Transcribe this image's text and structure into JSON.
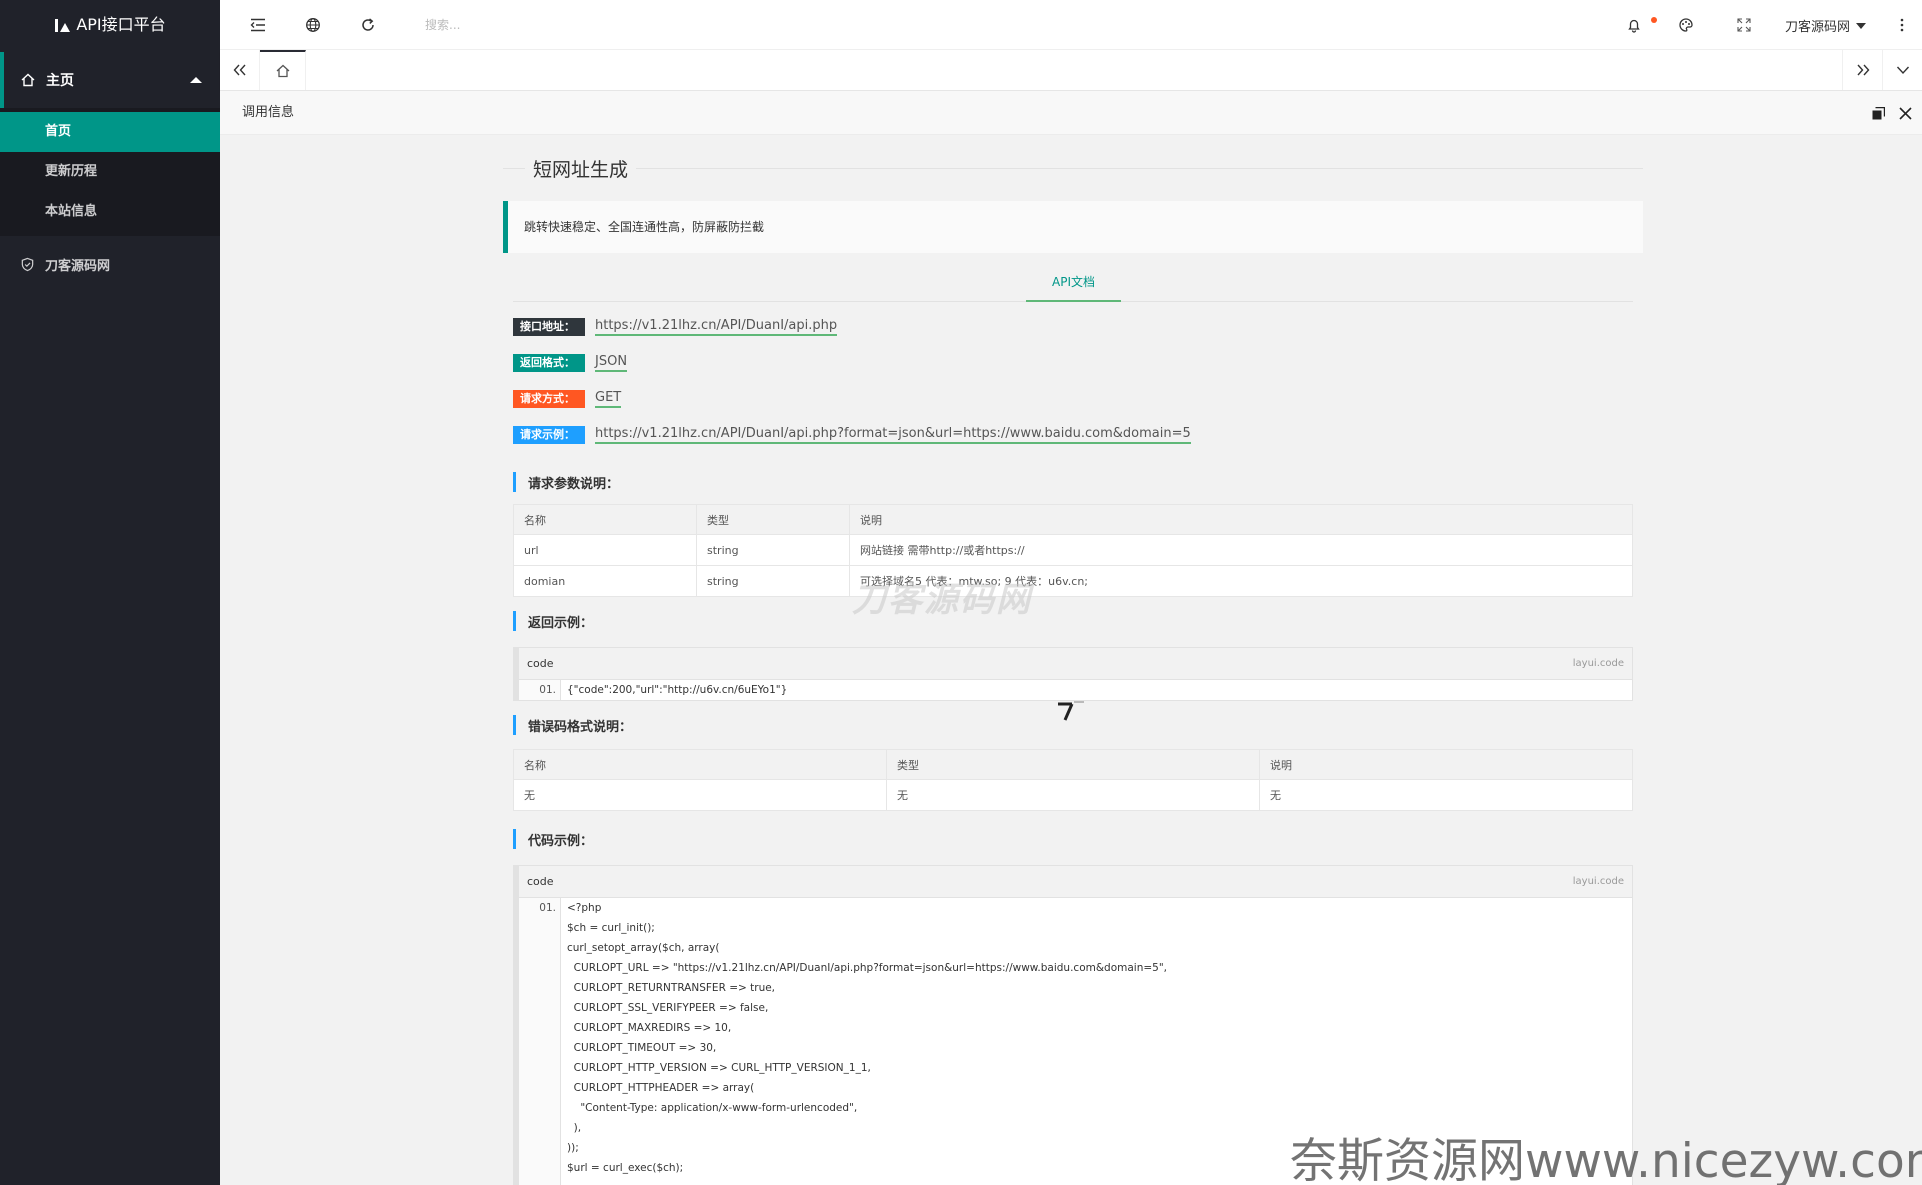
{
  "app": {
    "title": "API接口平台"
  },
  "sidebar": {
    "group_label": "主页",
    "items": [
      {
        "label": "首页",
        "active": true
      },
      {
        "label": "更新历程",
        "active": false
      },
      {
        "label": "本站信息",
        "active": false
      }
    ],
    "tail_label": "刀客源码网"
  },
  "header": {
    "search_placeholder": "搜索...",
    "user_name": "刀客源码网"
  },
  "tabs": {
    "home_icon": "home-icon"
  },
  "panel": {
    "title": "调用信息"
  },
  "doc": {
    "title": "短网址生成",
    "description": "跳转快速稳定、全国连通性高，防屏蔽防拦截",
    "api_tab": "API文档",
    "fields": [
      {
        "label": "接口地址：",
        "value": "https://v1.21lhz.cn/API/DuanI/api.php",
        "color": "#2f363c"
      },
      {
        "label": "返回格式：",
        "value": "JSON",
        "color": "#009688"
      },
      {
        "label": "请求方式：",
        "value": "GET",
        "color": "#ff5722"
      },
      {
        "label": "请求示例：",
        "value": "https://v1.21lhz.cn/API/DuanI/api.php?format=json&url=https://www.baidu.com&domain=5",
        "color": "#1e9fff"
      }
    ],
    "params_heading": "请求参数说明：",
    "params_table": {
      "headers": [
        "名称",
        "类型",
        "说明"
      ],
      "rows": [
        [
          "url",
          "string",
          "网站链接 需带http://或者https://"
        ],
        [
          "domian",
          "string",
          "可选择域名5 代表：mtw.so; 9 代表：u6v.cn;"
        ]
      ]
    },
    "return_heading": "返回示例：",
    "return_code": {
      "head": "code",
      "brand": "layui.code",
      "line_no": "01.",
      "lines": [
        "{\"code\":200,\"url\":\"http://u6v.cn/6uEYo1\"}"
      ]
    },
    "error_heading": "错误码格式说明：",
    "error_table": {
      "headers": [
        "名称",
        "类型",
        "说明"
      ],
      "rows": [
        [
          "无",
          "无",
          "无"
        ]
      ]
    },
    "example_heading": "代码示例：",
    "example_code": {
      "head": "code",
      "brand": "layui.code",
      "line_no": "01.",
      "lines": [
        "<?php",
        "$ch = curl_init();",
        "curl_setopt_array($ch, array(",
        "  CURLOPT_URL => \"https://v1.21lhz.cn/API/DuanI/api.php?format=json&url=https://www.baidu.com&domain=5\",",
        "  CURLOPT_RETURNTRANSFER => true,",
        "  CURLOPT_SSL_VERIFYPEER => false,",
        "  CURLOPT_MAXREDIRS => 10,",
        "  CURLOPT_TIMEOUT => 30,",
        "  CURLOPT_HTTP_VERSION => CURL_HTTP_VERSION_1_1,",
        "  CURLOPT_HTTPHEADER => array(",
        "    \"Content-Type: application/x-www-form-urlencoded\",",
        "  ),",
        "));",
        "$url = curl_exec($ch);"
      ]
    }
  },
  "watermarks": {
    "ghost": "刀客源码网",
    "footer": "奈斯资源网www.nicezyw.com"
  },
  "colors": {
    "accent": "#009688",
    "sidebar_bg": "#20222a",
    "blue": "#1e9fff"
  }
}
